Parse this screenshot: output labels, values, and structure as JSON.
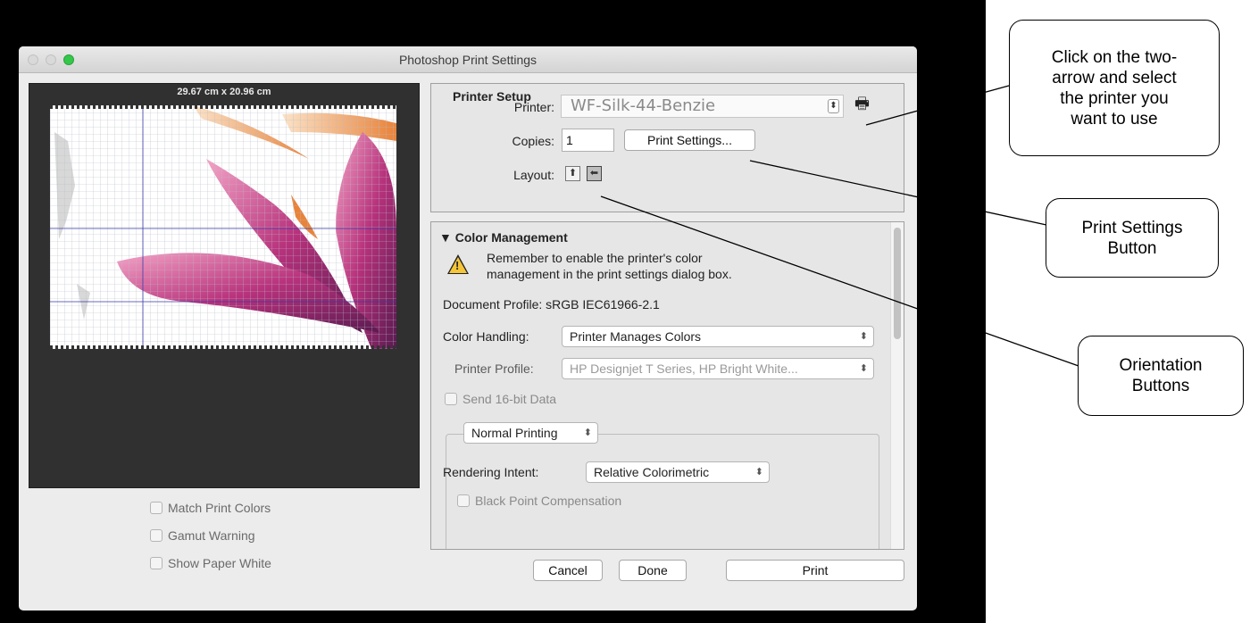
{
  "window": {
    "title": "Photoshop Print Settings"
  },
  "preview": {
    "dimensions": "29.67 cm x 20.96 cm",
    "options": [
      "Match Print Colors",
      "Gamut Warning",
      "Show Paper White"
    ]
  },
  "printer_setup": {
    "heading": "Printer Setup",
    "printer_label": "Printer:",
    "printer_value": "WF-Silk-44-Benzie",
    "copies_label": "Copies:",
    "copies_value": "1",
    "print_settings_button": "Print Settings...",
    "layout_label": "Layout:"
  },
  "color_management": {
    "heading": "Color Management",
    "warning_line1": "Remember to enable the printer's color",
    "warning_line2": "management in the print settings dialog box.",
    "document_profile": "Document Profile: sRGB IEC61966-2.1",
    "color_handling_label": "Color Handling:",
    "color_handling_value": "Printer Manages Colors",
    "printer_profile_label": "Printer Profile:",
    "printer_profile_value": "HP Designjet T Series, HP Bright White...",
    "send_16bit": "Send 16-bit Data",
    "printing_mode": "Normal Printing",
    "rendering_intent_label": "Rendering Intent:",
    "rendering_intent_value": "Relative Colorimetric",
    "black_point": "Black Point Compensation"
  },
  "buttons": {
    "cancel": "Cancel",
    "done": "Done",
    "print": "Print"
  },
  "annotations": {
    "printer_callout": [
      "Click on the two-",
      "arrow and select",
      "the printer you",
      "want to use"
    ],
    "settings_callout": [
      "Print Settings",
      "Button"
    ],
    "orientation_callout": [
      "Orientation",
      "Buttons"
    ]
  }
}
